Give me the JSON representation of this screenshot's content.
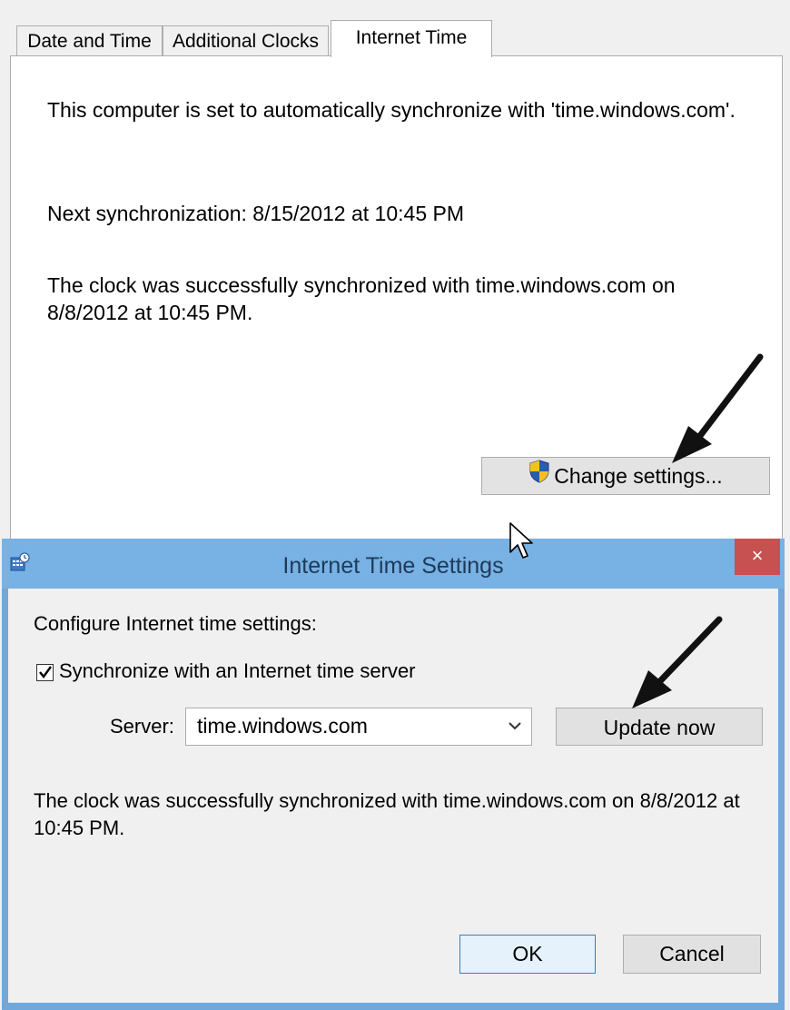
{
  "tabs": {
    "date_and_time": "Date and Time",
    "additional_clocks": "Additional Clocks",
    "internet_time": "Internet Time"
  },
  "internet_time_tab": {
    "sync_info": "This computer is set to automatically synchronize with 'time.windows.com'.",
    "next_sync": "Next synchronization: 8/15/2012 at 10:45 PM",
    "status": "The clock was successfully synchronized with time.windows.com on 8/8/2012 at 10:45 PM.",
    "change_settings_label": "Change settings..."
  },
  "settings_dialog": {
    "title": "Internet Time Settings",
    "close_symbol": "×",
    "configure_label": "Configure Internet time settings:",
    "sync_checkbox_label": "Synchronize with an Internet time server",
    "sync_checked": true,
    "server_label": "Server:",
    "server_value": "time.windows.com",
    "update_now_label": "Update now",
    "status": "The clock was successfully synchronized with time.windows.com on 8/8/2012 at 10:45 PM.",
    "ok_label": "OK",
    "cancel_label": "Cancel"
  },
  "icons": {
    "shield": "uac-shield-icon",
    "app": "clock-settings-icon",
    "dropdown": "chevron-down-icon",
    "check": "checkmark-icon"
  },
  "colors": {
    "titlebar": "#78b1e3",
    "close_button": "#c75050",
    "ok_border": "#3c7fb1"
  }
}
